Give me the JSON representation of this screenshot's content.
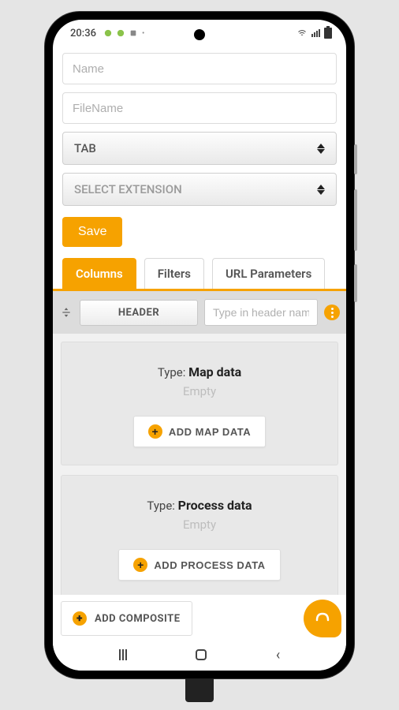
{
  "status": {
    "time": "20:36"
  },
  "form": {
    "name_placeholder": "Name",
    "filename_placeholder": "FileName",
    "tab_select_label": "TAB",
    "extension_select_label": "SELECT EXTENSION",
    "save_label": "Save"
  },
  "tabs": {
    "columns": "Columns",
    "filters": "Filters",
    "url_params": "URL Parameters"
  },
  "header_row": {
    "header_button_label": "HEADER",
    "header_input_placeholder": "Type in header nam"
  },
  "cards": {
    "map": {
      "type_prefix": "Type: ",
      "type_name": "Map data",
      "empty_label": "Empty",
      "add_label": "ADD MAP DATA"
    },
    "process": {
      "type_prefix": "Type: ",
      "type_name": "Process data",
      "empty_label": "Empty",
      "add_label": "ADD PROCESS DATA"
    }
  },
  "composite": {
    "add_label": "ADD COMPOSITE"
  },
  "colors": {
    "accent": "#f6a200"
  },
  "icons": {
    "plus": "plus-circle-icon",
    "kebab": "more-vertical-icon",
    "chat": "chat-bubble-icon",
    "drag": "drag-vertical-icon",
    "spinner": "spinner-arrows-icon"
  }
}
